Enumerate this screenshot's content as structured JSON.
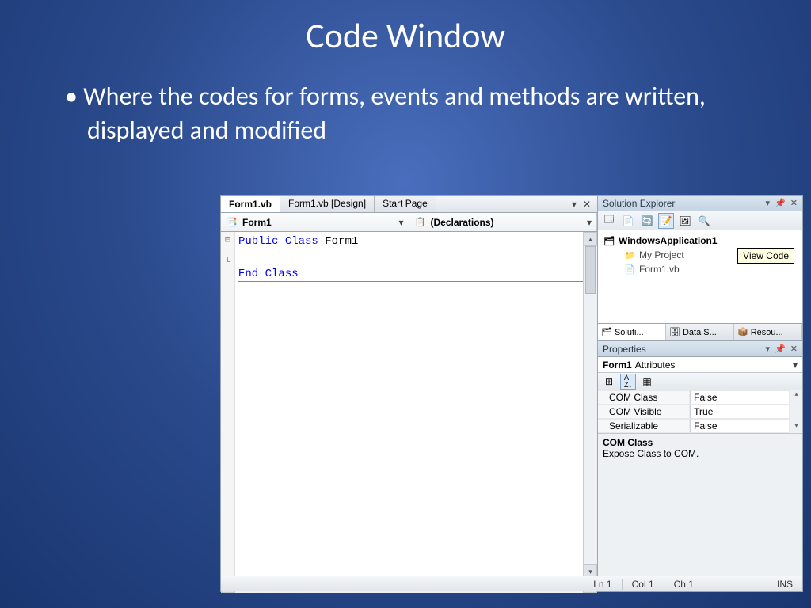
{
  "slide": {
    "title": "Code Window",
    "bullet": "Where the codes for forms, events and methods are written, displayed and modified"
  },
  "tabs": [
    "Form1.vb",
    "Form1.vb [Design]",
    "Start Page"
  ],
  "dropdowns": {
    "class": "Form1",
    "method": "(Declarations)"
  },
  "code": {
    "kw1": "Public",
    "kw2": "Class",
    "name": "Form1",
    "kw3": "End",
    "kw4": "Class"
  },
  "solution_explorer": {
    "title": "Solution Explorer",
    "project": "WindowsApplication1",
    "items": [
      "My Project",
      "Form1.vb"
    ],
    "tooltip": "View Code"
  },
  "bottom_tabs": [
    "Soluti...",
    "Data S...",
    "Resou..."
  ],
  "properties": {
    "title": "Properties",
    "object": "Form1",
    "subtitle": "Attributes",
    "rows": [
      {
        "name": "COM Class",
        "value": "False"
      },
      {
        "name": "COM Visible",
        "value": "True"
      },
      {
        "name": "Serializable",
        "value": "False"
      }
    ],
    "desc_title": "COM Class",
    "desc_text": "Expose Class to COM."
  },
  "status": {
    "ln": "Ln 1",
    "col": "Col 1",
    "ch": "Ch 1",
    "ins": "INS"
  }
}
